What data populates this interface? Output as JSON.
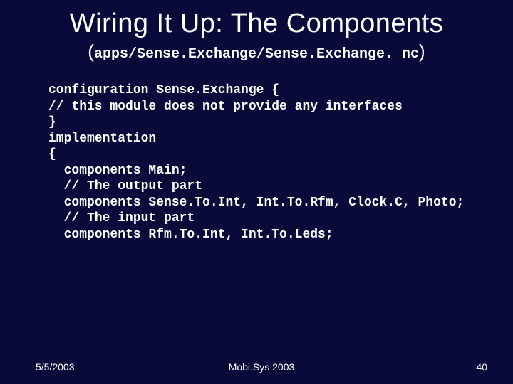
{
  "title": "Wiring It Up: The Components",
  "subtitle_path": "apps/Sense.Exchange/Sense.Exchange. nc",
  "code": "configuration Sense.Exchange {\n// this module does not provide any interfaces\n}\nimplementation\n{\n  components Main;\n  // The output part\n  components Sense.To.Int, Int.To.Rfm, Clock.C, Photo;\n  // The input part\n  components Rfm.To.Int, Int.To.Leds;",
  "footer": {
    "date": "5/5/2003",
    "venue": "Mobi.Sys 2003",
    "page": "40"
  }
}
